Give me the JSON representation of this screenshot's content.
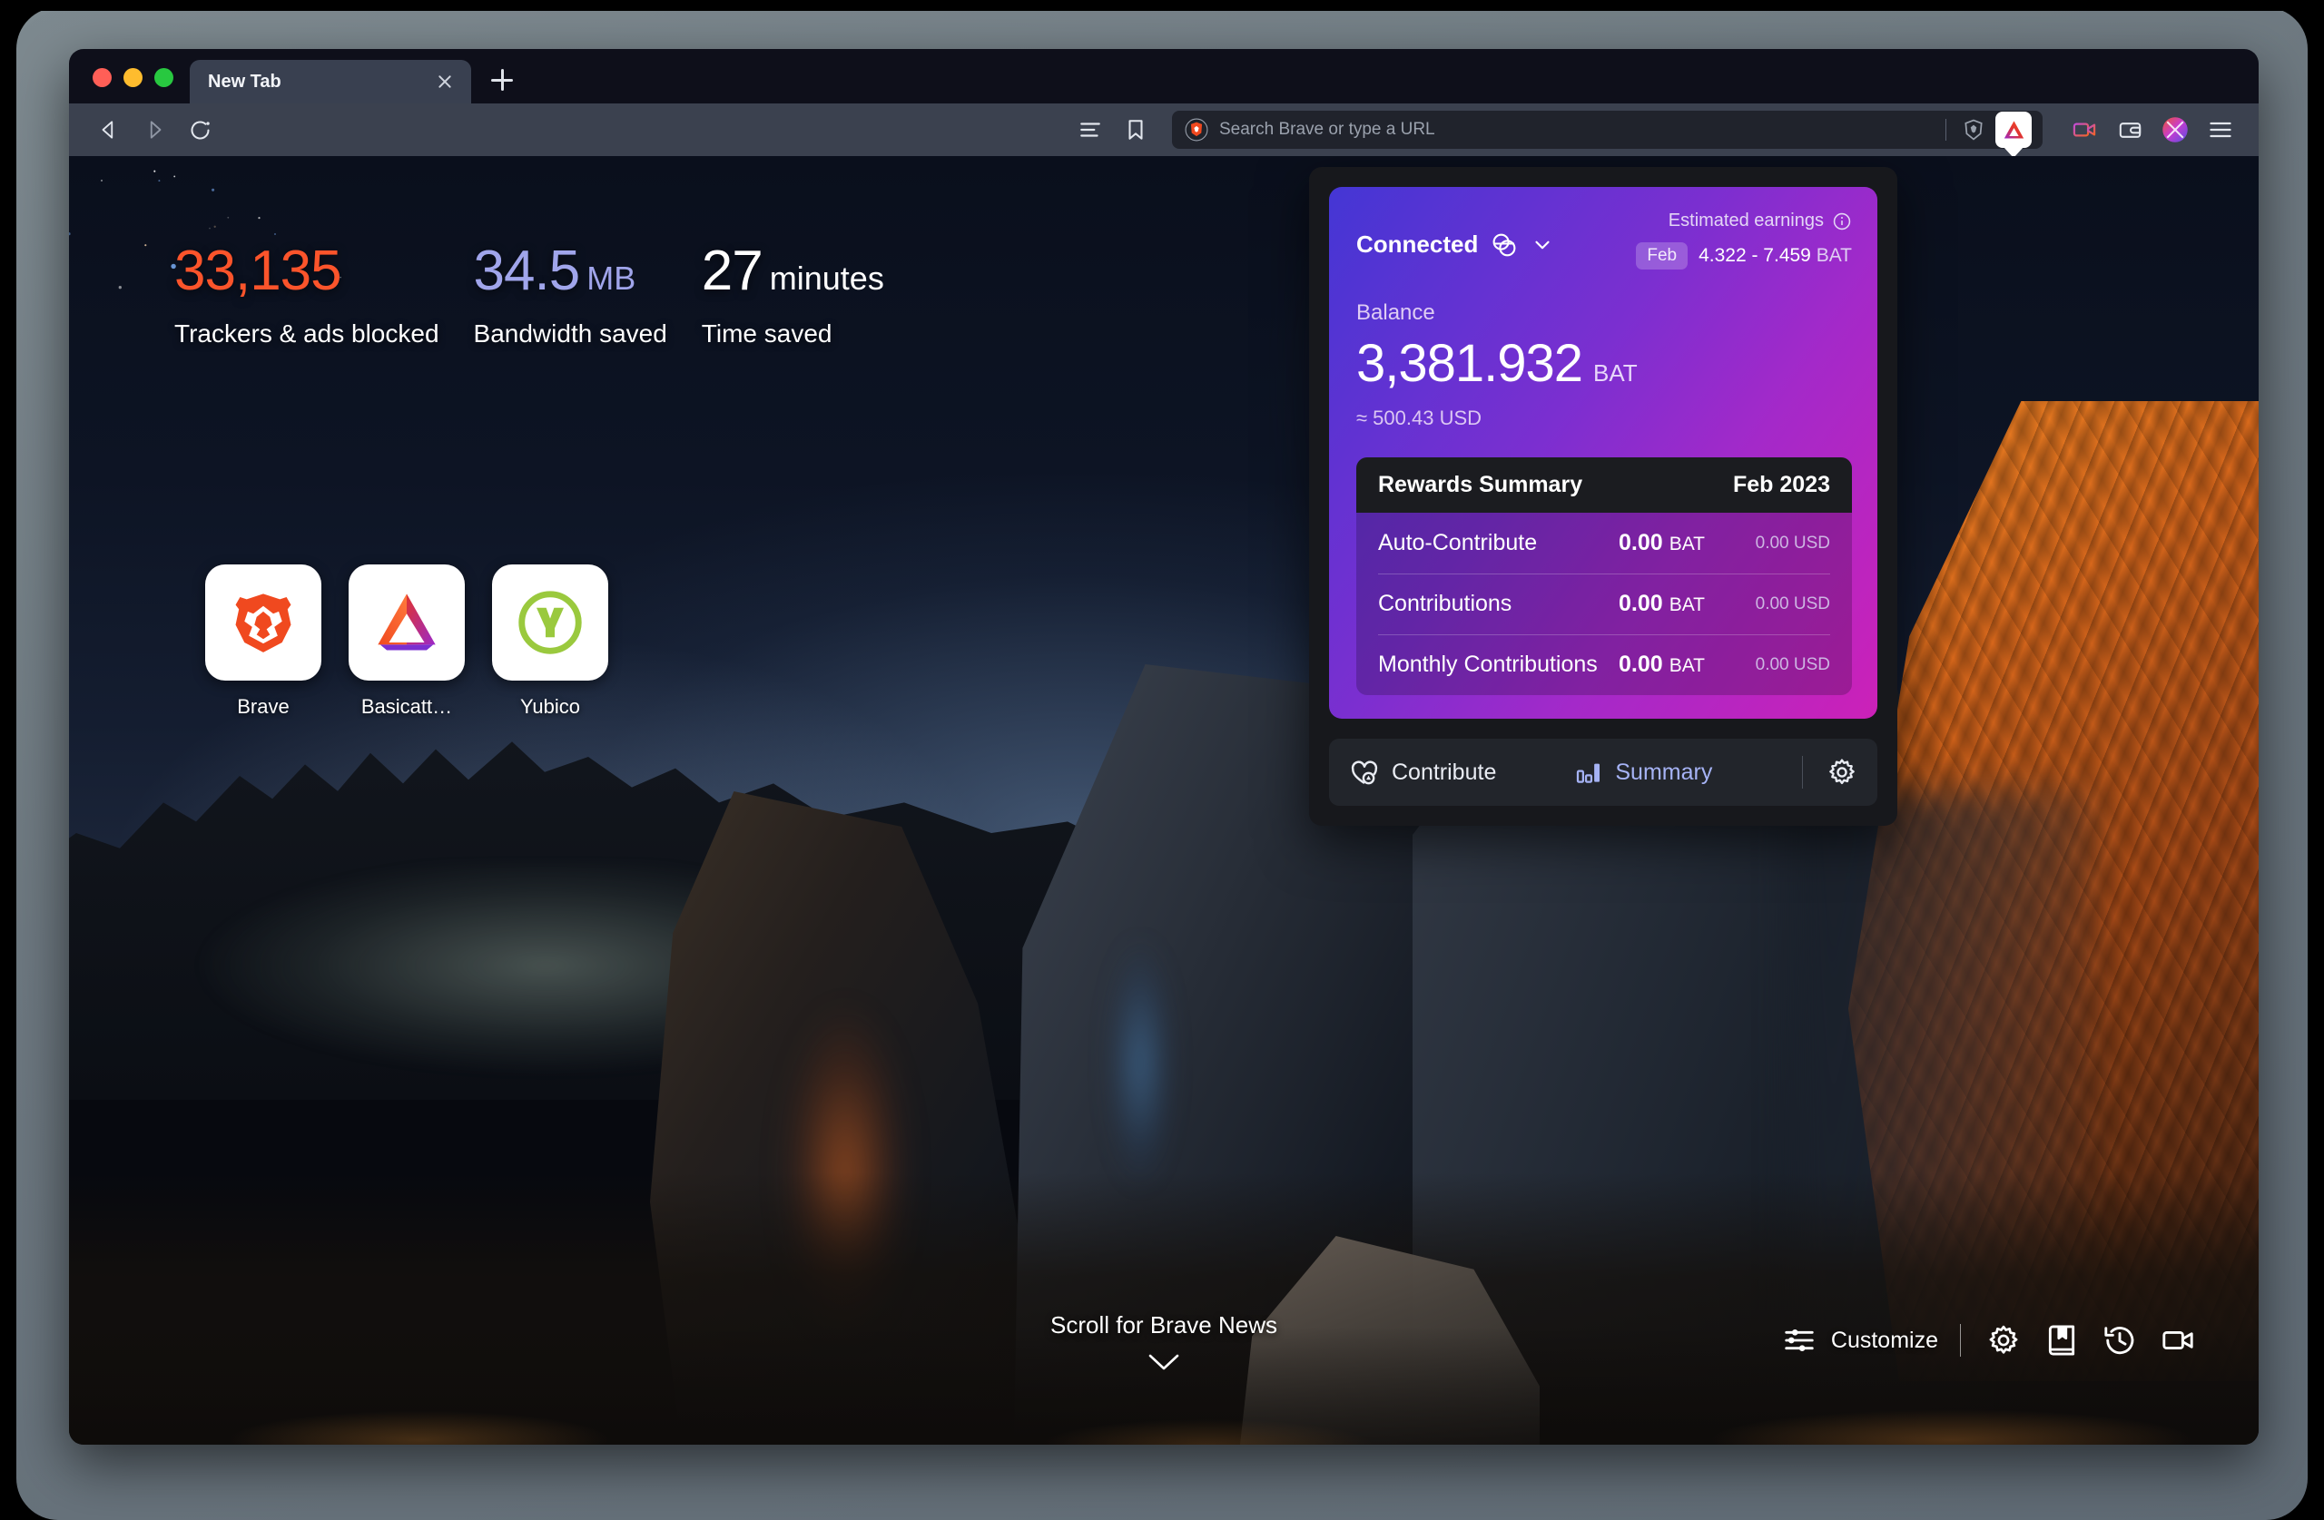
{
  "window": {
    "traffic_lights": [
      "close",
      "minimize",
      "maximize"
    ],
    "tab": {
      "title": "New Tab",
      "close_label": "×"
    },
    "new_tab_button": "+"
  },
  "toolbar": {
    "back": "back-arrow",
    "forward": "forward-arrow",
    "reload": "reload",
    "reading_list": "reading-list",
    "bookmarks": "bookmark",
    "omnibox": {
      "placeholder": "Search Brave or type a URL",
      "value": ""
    },
    "shields_icon": "brave-shields",
    "rewards_icon": "bat-rewards",
    "right_icons": [
      "video-call",
      "wallet",
      "profile-avatar",
      "browser-menu"
    ]
  },
  "newtab": {
    "stats": [
      {
        "value": "33,135",
        "unit": "",
        "label": "Trackers & ads blocked",
        "color": "#fb542b"
      },
      {
        "value": "34.5",
        "unit": "MB",
        "label": "Bandwidth saved",
        "color": "#a0a5eb"
      },
      {
        "value": "27",
        "unit": "minutes",
        "label": "Time saved",
        "color": "#ffffff"
      }
    ],
    "tiles": [
      {
        "label": "Brave",
        "icon": "brave-lion-icon"
      },
      {
        "label": "Basicatt…",
        "icon": "bat-triangle-icon"
      },
      {
        "label": "Yubico",
        "icon": "yubico-y-icon"
      }
    ],
    "scroll_hint": "Scroll for Brave News",
    "controls": {
      "customize": "Customize",
      "icons": [
        "settings-gear",
        "bookmarks-book",
        "history-clock",
        "video-camera"
      ]
    }
  },
  "rewards": {
    "connection": {
      "status": "Connected",
      "provider_icon": "gemini-icon",
      "chevron": "chevron-down-icon"
    },
    "estimated_earnings": {
      "title": "Estimated earnings",
      "info_icon": "info-icon",
      "period_badge": "Feb",
      "range": "4.322 - 7.459",
      "unit": "BAT"
    },
    "balance": {
      "label": "Balance",
      "amount": "3,381.932",
      "unit": "BAT",
      "usd": "≈ 500.43 USD"
    },
    "summary": {
      "title": "Rewards Summary",
      "period": "Feb 2023",
      "rows": [
        {
          "name": "Auto-Contribute",
          "bat": "0.00",
          "bat_unit": "BAT",
          "usd": "0.00 USD"
        },
        {
          "name": "Contributions",
          "bat": "0.00",
          "bat_unit": "BAT",
          "usd": "0.00 USD"
        },
        {
          "name": "Monthly Contributions",
          "bat": "0.00",
          "bat_unit": "BAT",
          "usd": "0.00 USD"
        }
      ]
    },
    "actions": {
      "contribute": "Contribute",
      "contribute_icon": "heart-bat-icon",
      "summary": "Summary",
      "summary_icon": "bar-chart-icon",
      "settings_icon": "gear-icon"
    }
  },
  "colors": {
    "accent_orange": "#fb542b",
    "accent_purple": "#a0a5eb",
    "card_gradient_start": "#4436d4",
    "card_gradient_end": "#cc21b8",
    "summary_link": "#a6b3f5"
  }
}
